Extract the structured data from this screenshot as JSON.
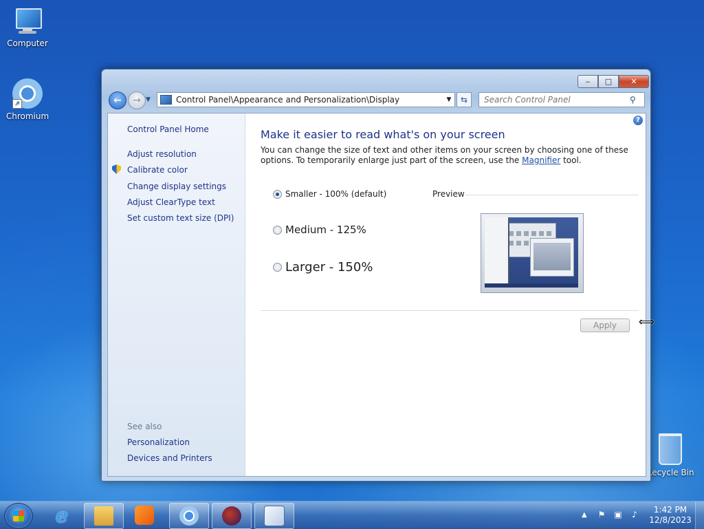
{
  "desktop": {
    "icons": [
      {
        "label": "Computer"
      },
      {
        "label": "Chromium"
      },
      {
        "label": "Recycle Bin"
      }
    ]
  },
  "window": {
    "controls": {
      "minimize": "▭",
      "maximize": "□",
      "close": "✕"
    },
    "address": {
      "path": "Control Panel\\Appearance and Personalization\\Display"
    },
    "search": {
      "placeholder": "Search Control Panel"
    }
  },
  "sidebar": {
    "home": "Control Panel Home",
    "links": [
      "Adjust resolution",
      "Calibrate color",
      "Change display settings",
      "Adjust ClearType text",
      "Set custom text size (DPI)"
    ],
    "see_also_label": "See also",
    "see_also": [
      "Personalization",
      "Devices and Printers"
    ]
  },
  "main": {
    "title": "Make it easier to read what's on your screen",
    "description_part1": "You can change the size of text and other items on your screen by choosing one of these options. To temporarily enlarge just part of the screen, use the ",
    "magnifier_link": "Magnifier",
    "description_part2": " tool.",
    "options": [
      {
        "label": "Smaller - 100% (default)",
        "selected": true
      },
      {
        "label": "Medium - 125%",
        "selected": false
      },
      {
        "label": "Larger - 150%",
        "selected": false
      }
    ],
    "preview_label": "Preview",
    "apply_label": "Apply"
  },
  "taskbar": {
    "apps": [
      "start",
      "internet-explorer",
      "file-explorer",
      "media-player",
      "chromium",
      "firefox",
      "control-panel"
    ],
    "clock": {
      "time": "1:42 PM",
      "date": "12/8/2023"
    }
  },
  "colors": {
    "link": "#1e3287",
    "accent": "#1e50a8"
  }
}
